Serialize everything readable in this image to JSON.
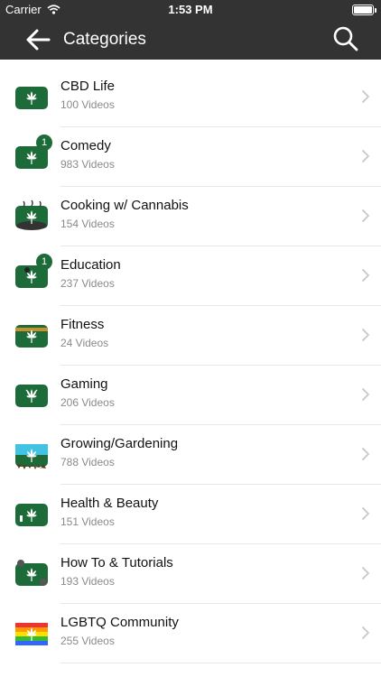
{
  "status_bar": {
    "carrier": "Carrier",
    "time": "1:53 PM"
  },
  "nav": {
    "title": "Categories",
    "back_icon": "arrow-left-icon",
    "search_icon": "search-icon"
  },
  "accent": "#1e6b3a",
  "categories": [
    {
      "title": "CBD Life",
      "count": "100 Videos",
      "badge": ""
    },
    {
      "title": "Comedy",
      "count": "983 Videos",
      "badge": "1"
    },
    {
      "title": "Cooking w/ Cannabis",
      "count": "154 Videos",
      "badge": ""
    },
    {
      "title": "Education",
      "count": "237 Videos",
      "badge": "1"
    },
    {
      "title": "Fitness",
      "count": "24 Videos",
      "badge": ""
    },
    {
      "title": "Gaming",
      "count": "206 Videos",
      "badge": ""
    },
    {
      "title": "Growing/Gardening",
      "count": "788 Videos",
      "badge": ""
    },
    {
      "title": "Health & Beauty",
      "count": "151 Videos",
      "badge": ""
    },
    {
      "title": "How To & Tutorials",
      "count": "193 Videos",
      "badge": ""
    },
    {
      "title": "LGBTQ Community",
      "count": "255 Videos",
      "badge": ""
    }
  ]
}
